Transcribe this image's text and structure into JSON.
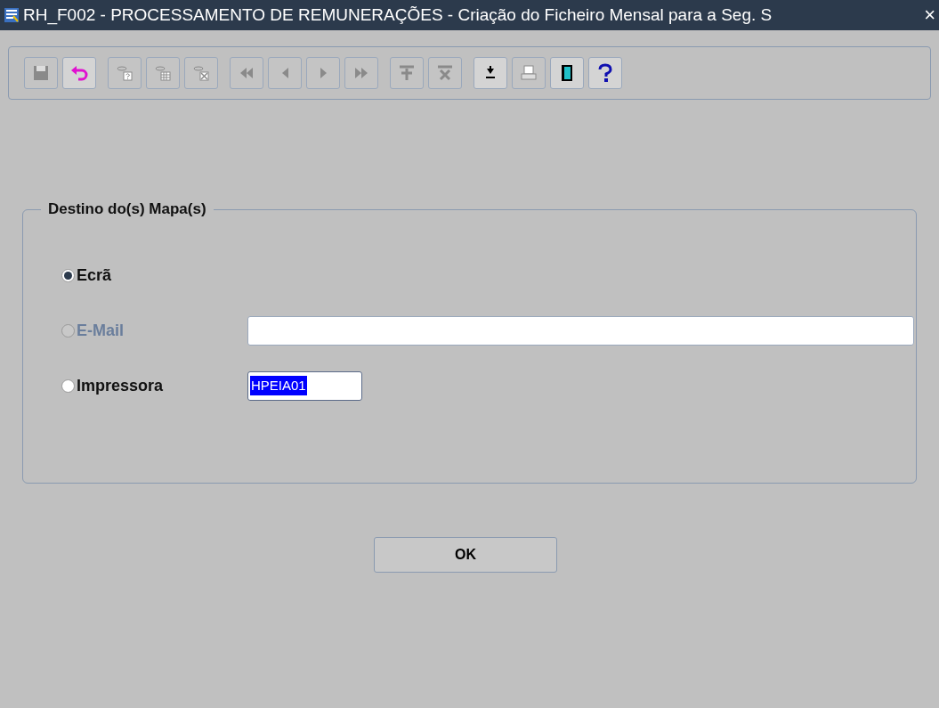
{
  "window": {
    "title": "RH_F002 - PROCESSAMENTO DE REMUNERAÇÕES - Criação do Ficheiro Mensal para a Seg. S",
    "close": "×"
  },
  "toolbar_groups": [
    [
      {
        "kind": "save",
        "disabled": true
      },
      {
        "kind": "undo",
        "disabled": false
      }
    ],
    [
      {
        "kind": "query",
        "disabled": true
      },
      {
        "kind": "execute",
        "disabled": true
      },
      {
        "kind": "cancel",
        "disabled": true
      }
    ],
    [
      {
        "kind": "first",
        "disabled": true
      },
      {
        "kind": "prev",
        "disabled": true
      },
      {
        "kind": "next",
        "disabled": true
      },
      {
        "kind": "last",
        "disabled": true
      }
    ],
    [
      {
        "kind": "insert",
        "disabled": true
      },
      {
        "kind": "delete",
        "disabled": true
      }
    ],
    [
      {
        "kind": "download",
        "disabled": false
      },
      {
        "kind": "print",
        "disabled": true
      },
      {
        "kind": "exit",
        "disabled": false
      },
      {
        "kind": "help",
        "disabled": false
      }
    ]
  ],
  "frame": {
    "title": "Destino do(s) Mapa(s)",
    "options": [
      {
        "label": "Ecrã",
        "selected": true,
        "disabled": false
      },
      {
        "label": "E-Mail",
        "selected": false,
        "disabled": true,
        "field": {
          "highlighted": false
        }
      },
      {
        "label": "Impressora",
        "selected": false,
        "disabled": false,
        "field": {
          "value": "HPEIA01",
          "highlighted": true
        }
      }
    ]
  },
  "ok_button": "OK"
}
